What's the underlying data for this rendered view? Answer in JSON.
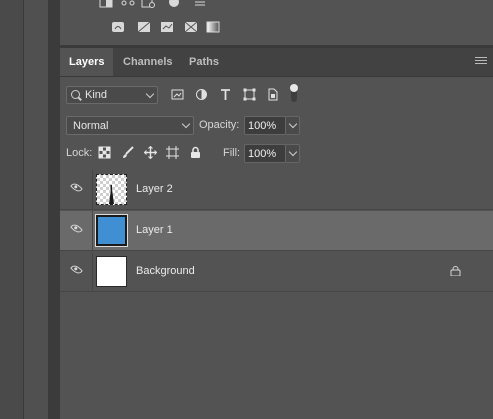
{
  "tabs": [
    {
      "label": "Layers",
      "active": true
    },
    {
      "label": "Channels",
      "active": false
    },
    {
      "label": "Paths",
      "active": false
    }
  ],
  "filter": {
    "kind_label": "Kind",
    "icons": [
      "pixel-filter-icon",
      "adjustment-filter-icon",
      "type-filter-icon",
      "shape-filter-icon",
      "smart-object-filter-icon",
      "filter-toggle"
    ]
  },
  "blend": {
    "mode": "Normal",
    "opacity_label": "Opacity:",
    "opacity_value": "100%",
    "fill_label": "Fill:",
    "fill_value": "100%"
  },
  "lock": {
    "label": "Lock:",
    "icons": [
      "lock-transparent-pixels-icon",
      "lock-image-pixels-icon",
      "lock-position-icon",
      "lock-artboard-icon",
      "lock-all-icon"
    ]
  },
  "layers": [
    {
      "name": "Layer 2",
      "visible": true,
      "selected": false,
      "thumb": "checker"
    },
    {
      "name": "Layer 1",
      "visible": true,
      "selected": true,
      "thumb": "blue",
      "thumb_color": "#3f8fd2"
    },
    {
      "name": "Background",
      "visible": true,
      "selected": false,
      "thumb": "white",
      "locked": true
    }
  ],
  "colors": {
    "panel_bg": "#535353",
    "selected_row": "#6a6a6a",
    "tab_bar": "#424242"
  }
}
